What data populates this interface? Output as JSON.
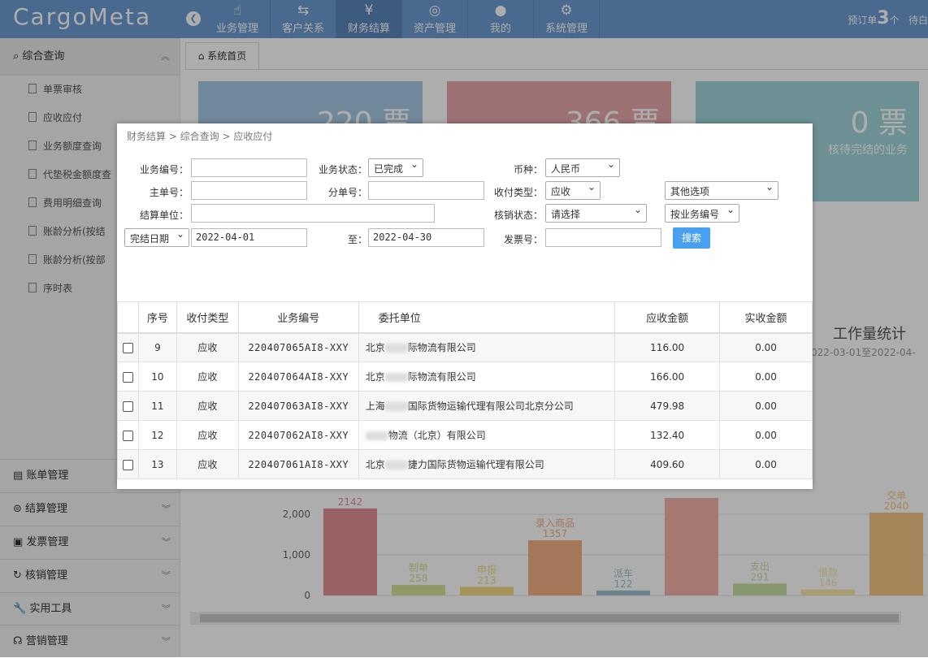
{
  "app": {
    "logo": "CargoMeta",
    "collapse_icon": "chevron-left-icon"
  },
  "nav": [
    {
      "label": "业务管理",
      "icon": "hand-pointer-icon",
      "glyph": "☝"
    },
    {
      "label": "客户关系",
      "icon": "handshake-icon",
      "glyph": "🤝"
    },
    {
      "label": "财务结算",
      "icon": "yen-icon",
      "glyph": "¥",
      "active": true
    },
    {
      "label": "资产管理",
      "icon": "basketball-icon",
      "glyph": "◎"
    },
    {
      "label": "我的",
      "icon": "user-icon",
      "glyph": "👤"
    },
    {
      "label": "系统管理",
      "icon": "gear-icon",
      "glyph": "⚙"
    }
  ],
  "top_right": {
    "prefix": "预订单",
    "count": "3",
    "suffix": "个",
    "extra": "待白"
  },
  "sidebar": {
    "head": "综合查询",
    "items": [
      "单票审核",
      "应收应付",
      "业务额度查询",
      "代垫税金额度查",
      "费用明细查询",
      "账龄分析(按结",
      "账龄分析(按部",
      "序时表"
    ],
    "groups": [
      "账单管理",
      "结算管理",
      "发票管理",
      "核销管理",
      "实用工具",
      "营销管理"
    ]
  },
  "tab": {
    "label": "系统首页"
  },
  "cards": [
    {
      "num": "220 票",
      "desc": "",
      "color": "#a7c7e3"
    },
    {
      "num": "366 票",
      "desc": "",
      "color": "#e6a8ab"
    },
    {
      "num": "0 票",
      "desc": "核待完结的业务",
      "color": "#9fd4d9"
    }
  ],
  "workload": {
    "title": "工作量统计",
    "range": "022-03-01至2022-04-"
  },
  "chart_data": {
    "type": "bar",
    "categories": [
      "",
      "制单",
      "申报",
      "录入商品",
      "派车",
      "",
      "支出",
      "借款",
      "交单"
    ],
    "values": [
      2142,
      258,
      213,
      1357,
      122,
      2400,
      291,
      146,
      2040
    ],
    "value_labels": [
      "2142",
      "258",
      "213",
      "1357",
      "122",
      "",
      "291",
      "146",
      "2040"
    ],
    "colors": [
      "#e48f96",
      "#d5e097",
      "#f5d983",
      "#f2b083",
      "#9fc2d2",
      "#f5b1a8",
      "#c8e0a4",
      "#f7e7a6",
      "#f6c585"
    ],
    "yticks": [
      "0",
      "1,000",
      "2,000"
    ],
    "ylim": [
      0,
      2600
    ]
  },
  "modal": {
    "breadcrumb": "财务结算 > 综合查询 > 应收应付",
    "form": {
      "biz_no_label": "业务编号：",
      "biz_status_label": "业务状态：",
      "biz_status_value": "已完成",
      "currency_label": "币种：",
      "currency_value": "人民币",
      "master_no_label": "主单号：",
      "sub_no_label": "分单号：",
      "pay_type_label": "收付类型：",
      "pay_type_value": "应收",
      "other_value": "其他选项",
      "settle_unit_label": "结算单位：",
      "writeoff_label": "核销状态：",
      "writeoff_value": "请选择",
      "sort_value": "按业务编号",
      "date_type_value": "完结日期",
      "date_from": "2022-04-01",
      "to_label": "至：",
      "date_to": "2022-04-30",
      "invoice_label": "发票号：",
      "search_label": "搜索"
    },
    "table": {
      "headers": [
        "",
        "序号",
        "收付类型",
        "业务编号",
        "委托单位",
        "应收金额",
        "实收金额"
      ],
      "rows": [
        {
          "no": "9",
          "type": "应收",
          "biz": "220407065AI8-XXY",
          "client_a": "北京",
          "client_b": "际物流有限公司",
          "amount": "116.00",
          "received": "0.00"
        },
        {
          "no": "10",
          "type": "应收",
          "biz": "220407064AI8-XXY",
          "client_a": "北京",
          "client_b": "际物流有限公司",
          "amount": "166.00",
          "received": "0.00"
        },
        {
          "no": "11",
          "type": "应收",
          "biz": "220407063AI8-XXY",
          "client_a": "上海",
          "client_b": "国际货物运输代理有限公司北京分公司",
          "amount": "479.98",
          "received": "0.00"
        },
        {
          "no": "12",
          "type": "应收",
          "biz": "220407062AI8-XXY",
          "client_a": "",
          "client_b": "物流（北京）有限公司",
          "amount": "132.40",
          "received": "0.00"
        },
        {
          "no": "13",
          "type": "应收",
          "biz": "220407061AI8-XXY",
          "client_a": "北京",
          "client_b": "捷力国际货物运输代理有限公司",
          "amount": "409.60",
          "received": "0.00"
        }
      ]
    }
  }
}
